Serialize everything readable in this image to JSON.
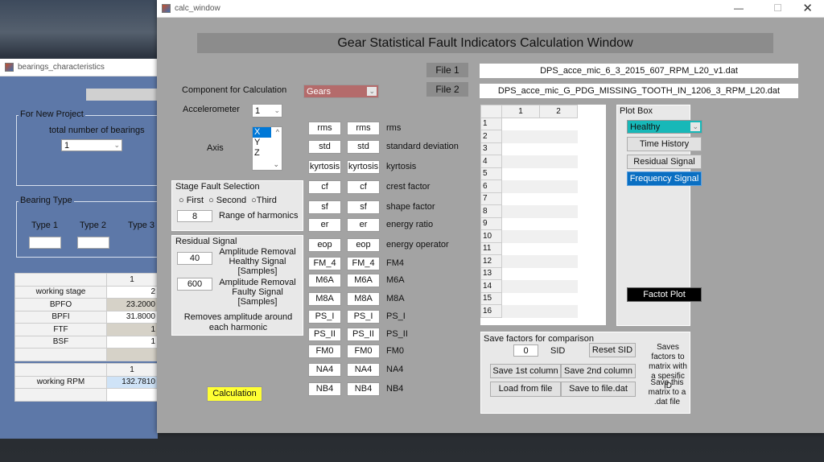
{
  "bearings_window": {
    "title": "bearings_characteristics",
    "new_project_group": "For New Project",
    "total_bearings_label": "total number of bearings",
    "total_bearings_value": "1",
    "bearing_type_group": "Bearing Type",
    "types": [
      "Type 1",
      "Type 2",
      "Type 3"
    ],
    "table1": {
      "col_header": "1",
      "rows": [
        {
          "label": "working stage",
          "value": "2"
        },
        {
          "label": "BPFO",
          "value": "23.2000"
        },
        {
          "label": "BPFI",
          "value": "31.8000"
        },
        {
          "label": "FTF",
          "value": "1"
        },
        {
          "label": "BSF",
          "value": "1"
        },
        {
          "label": "",
          "value": ""
        }
      ]
    },
    "table2": {
      "col_header": "1",
      "rows": [
        {
          "label": "working RPM",
          "value": "132.7810"
        },
        {
          "label": "",
          "value": ""
        }
      ]
    }
  },
  "calc_window": {
    "title": "calc_window",
    "heading": "Gear Statistical Fault Indicators Calculation Window",
    "file1_label": "File 1",
    "file1_value": "DPS_acce_mic_6_3_2015_607_RPM_L20_v1.dat",
    "file2_label": "File 2",
    "file2_value": "DPS_acce_mic_G_PDG_MISSING_TOOTH_IN_1206_3_RPM_L20.dat",
    "component_label": "Component for Calculation",
    "component_value": "Gears",
    "component_color": "#b46b6b",
    "accelerometer_label": "Accelerometer",
    "accelerometer_value": "1",
    "axis_label": "Axis",
    "axis_options": [
      "X",
      "Y",
      "Z"
    ],
    "axis_selected": "X",
    "stage_group": "Stage Fault Selection",
    "stage_options": [
      "First",
      "Second",
      "Third"
    ],
    "harmonics_value": "8",
    "harmonics_label": "Range of harmonics",
    "residual_group": "Residual Signal",
    "healthy_value": "40",
    "healthy_label": "Amplitude Removal Healthy Signal [Samples]",
    "faulty_value": "600",
    "faulty_label": "Amplitude Removal Faulty Signal [Samples]",
    "residual_note": "Removes amplitude around each harmonic",
    "calculation_button": "Calculation",
    "metrics": [
      {
        "b": "rms",
        "l": "rms"
      },
      {
        "b": "std",
        "l": "standard deviation"
      },
      {
        "b": "kyrtosis",
        "l": "kyrtosis"
      },
      {
        "b": "cf",
        "l": "crest factor"
      },
      {
        "b": "sf",
        "l": "shape factor"
      },
      {
        "b": "er",
        "l": "energy ratio"
      },
      {
        "b": "eop",
        "l": "energy operator"
      },
      {
        "b": "FM_4",
        "l": "FM4"
      },
      {
        "b": "M6A",
        "l": "M6A"
      },
      {
        "b": "M8A",
        "l": "M8A"
      },
      {
        "b": "PS_I",
        "l": "PS_I"
      },
      {
        "b": "PS_II",
        "l": "PS_II"
      },
      {
        "b": "FM0",
        "l": "FM0"
      },
      {
        "b": "NA4",
        "l": "NA4"
      },
      {
        "b": "NB4",
        "l": "NB4"
      }
    ],
    "results_table": {
      "columns": [
        "1",
        "2"
      ],
      "rows": [
        "1",
        "2",
        "3",
        "4",
        "5",
        "6",
        "7",
        "8",
        "9",
        "10",
        "11",
        "12",
        "13",
        "14",
        "15",
        "16"
      ]
    },
    "plot_box": {
      "title": "Plot Box",
      "select_value": "Healthy",
      "select_color": "#17b8b8",
      "time_history": "Time History",
      "residual_signal": "Residual Signal",
      "frequency_signal": "Frequency Signal",
      "factor_plot": "Factot Plot"
    },
    "save_box": {
      "title": "Save factors for comparison",
      "sid_value": "0",
      "sid_label": "SID",
      "reset_sid": "Reset SID",
      "save_1st": "Save 1st column",
      "save_2nd": "Save 2nd column",
      "load": "Load from file",
      "save_file": "Save to file.dat",
      "note1": "Saves factors to matrix with a spesific ID",
      "note2": "Save this matrix to a .dat file"
    }
  }
}
